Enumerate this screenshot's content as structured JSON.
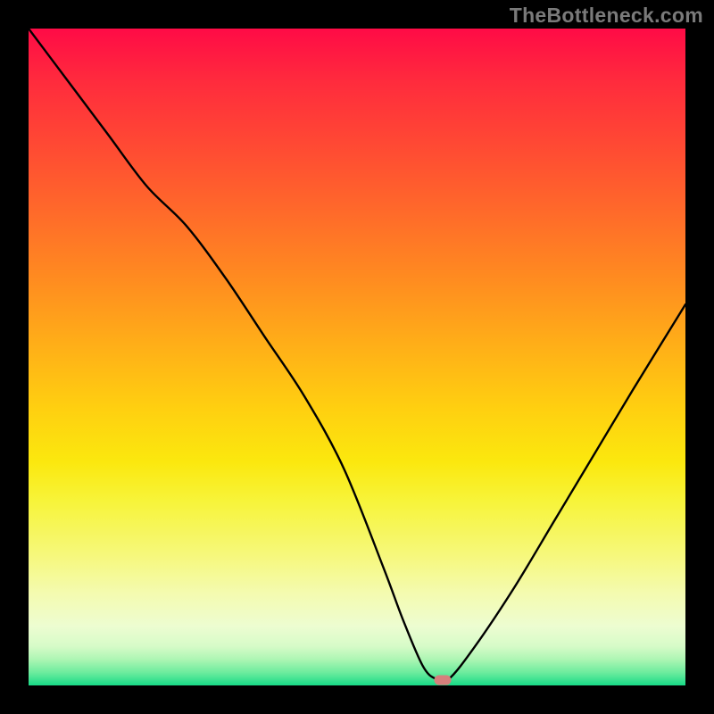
{
  "watermark": "TheBottleneck.com",
  "chart_data": {
    "type": "line",
    "title": "",
    "xlabel": "",
    "ylabel": "",
    "xlim": [
      0,
      100
    ],
    "ylim": [
      0,
      100
    ],
    "x": [
      0,
      6,
      12,
      18,
      24,
      30,
      36,
      42,
      48,
      54,
      57,
      60,
      62,
      64,
      68,
      74,
      80,
      86,
      92,
      100
    ],
    "values": [
      100,
      92,
      84,
      76,
      70,
      62,
      53,
      44,
      33,
      18,
      10,
      3,
      1,
      1,
      6,
      15,
      25,
      35,
      45,
      58
    ],
    "marker": {
      "x": 63,
      "y": 0.8
    },
    "background_gradient": {
      "type": "vertical",
      "stops": [
        {
          "pos": 0,
          "color": "#ff0b46"
        },
        {
          "pos": 50,
          "color": "#ffae18"
        },
        {
          "pos": 72,
          "color": "#f7f43a"
        },
        {
          "pos": 100,
          "color": "#18da87"
        }
      ]
    }
  }
}
